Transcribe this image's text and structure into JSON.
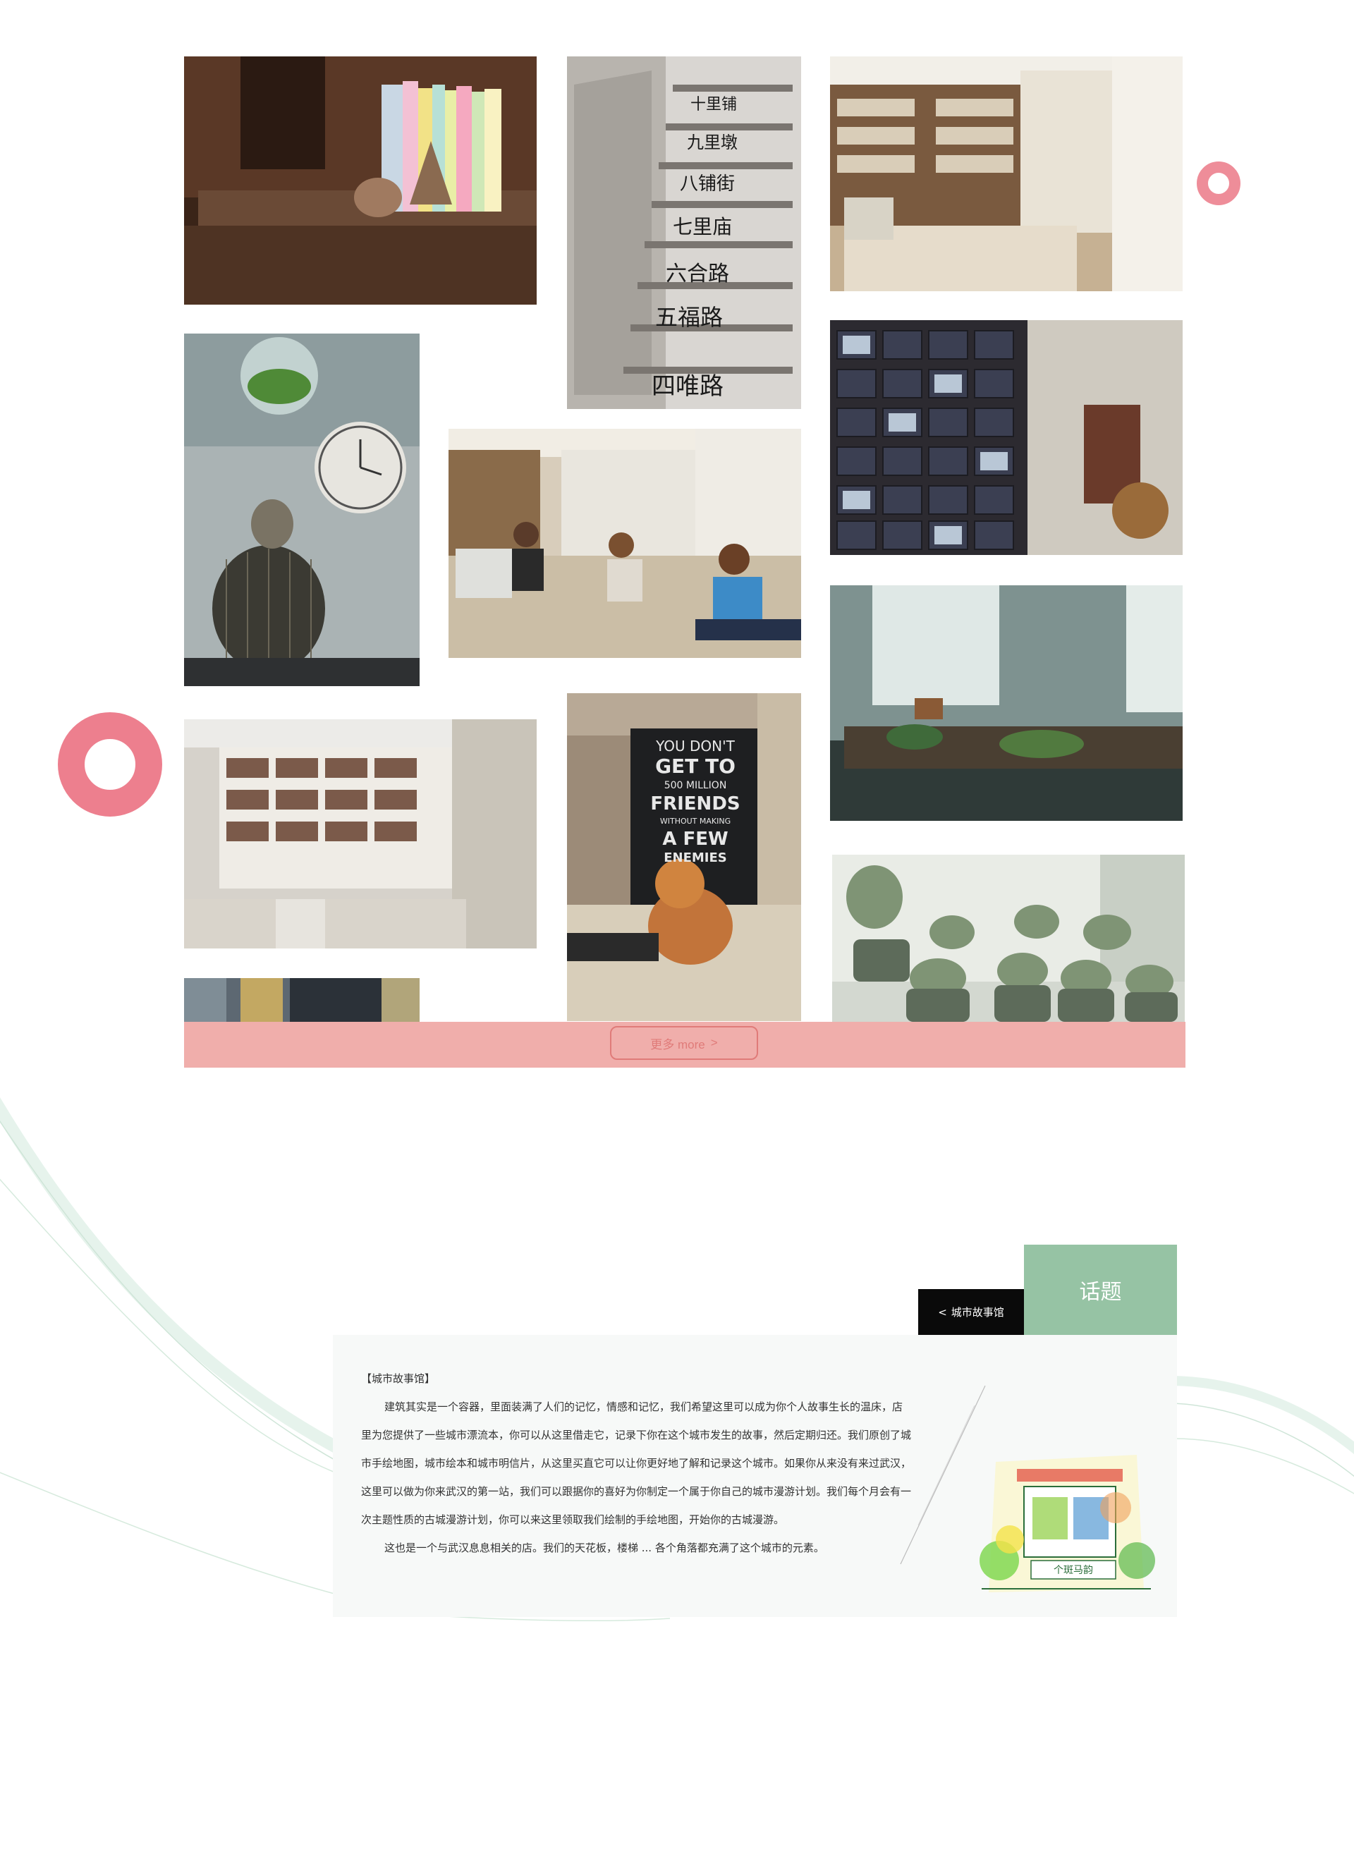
{
  "colors": {
    "accent_pink": "#f0aeab",
    "accent_pink_border": "#e07b79",
    "topic_green": "#96c3a4",
    "subtitle_black": "#0a0a0a",
    "card_bg": "#f7f9f8"
  },
  "gallery": {
    "photos": [
      {
        "name": "photo-books-shelf",
        "icon": "books-squirrel-shelf"
      },
      {
        "name": "photo-painted-stairs",
        "icon": "painted-stairs",
        "stair_text": [
          "十里铺",
          "九里墩",
          "八铺街",
          "七里庙",
          "六合路",
          "五福路",
          "四唯路"
        ]
      },
      {
        "name": "photo-bookstore-interior",
        "icon": "bookstore-interior"
      },
      {
        "name": "photo-cat-birdcage-clock",
        "icon": "cat-clock-birdcage"
      },
      {
        "name": "photo-people-in-cafe",
        "icon": "people-cafe"
      },
      {
        "name": "photo-framed-photo-wall",
        "icon": "photo-wall"
      },
      {
        "name": "photo-deer-terrarium",
        "icon": "deer-terrarium"
      },
      {
        "name": "photo-library-room",
        "icon": "library-room"
      },
      {
        "name": "photo-cat-on-table",
        "icon": "cat-poster",
        "poster_text": [
          "YOU DON'T",
          "GET TO",
          "500 MILLION",
          "FRIENDS",
          "WITHOUT MAKING",
          "A FEW",
          "ENEMIES"
        ]
      },
      {
        "name": "photo-succulents",
        "icon": "succulent-pots"
      },
      {
        "name": "photo-partial-bottom",
        "icon": "partial-photo"
      }
    ]
  },
  "more_button": {
    "label": "更多 more",
    "arrow": ">"
  },
  "topic": {
    "tag": "话题",
    "subtitle_arrow": "<",
    "subtitle": "城市故事馆"
  },
  "story": {
    "title": "【城市故事馆】",
    "paragraph1": "建筑其实是一个容器，里面装满了人们的记忆，情感和记忆，我们希望这里可以成为你个人故事生长的温床，店里为您提供了一些城市漂流本，你可以从这里借走它，记录下你在这个城市发生的故事，然后定期归还。我们原创了城市手绘地图，城市绘本和城市明信片，从这里买直它可以让你更好地了解和记录这个城市。如果你从来没有来过武汉，这里可以做为你来武汉的第一站，我们可以跟据你的喜好为你制定一个属于你自己的城市漫游计划。我们每个月会有一次主题性质的古城漫游计划，你可以来这里领取我们绘制的手绘地图，开始你的古城漫游。",
    "paragraph2": "这也是一个与武汉息息相关的店。我们的天花板，楼梯 ... 各个角落都充满了这个城市的元素。",
    "illustration_sign": "个斑马韵"
  },
  "decor": {
    "ring_small_icon": "pink-ring-icon",
    "ring_large_icon": "pink-ring-icon"
  }
}
